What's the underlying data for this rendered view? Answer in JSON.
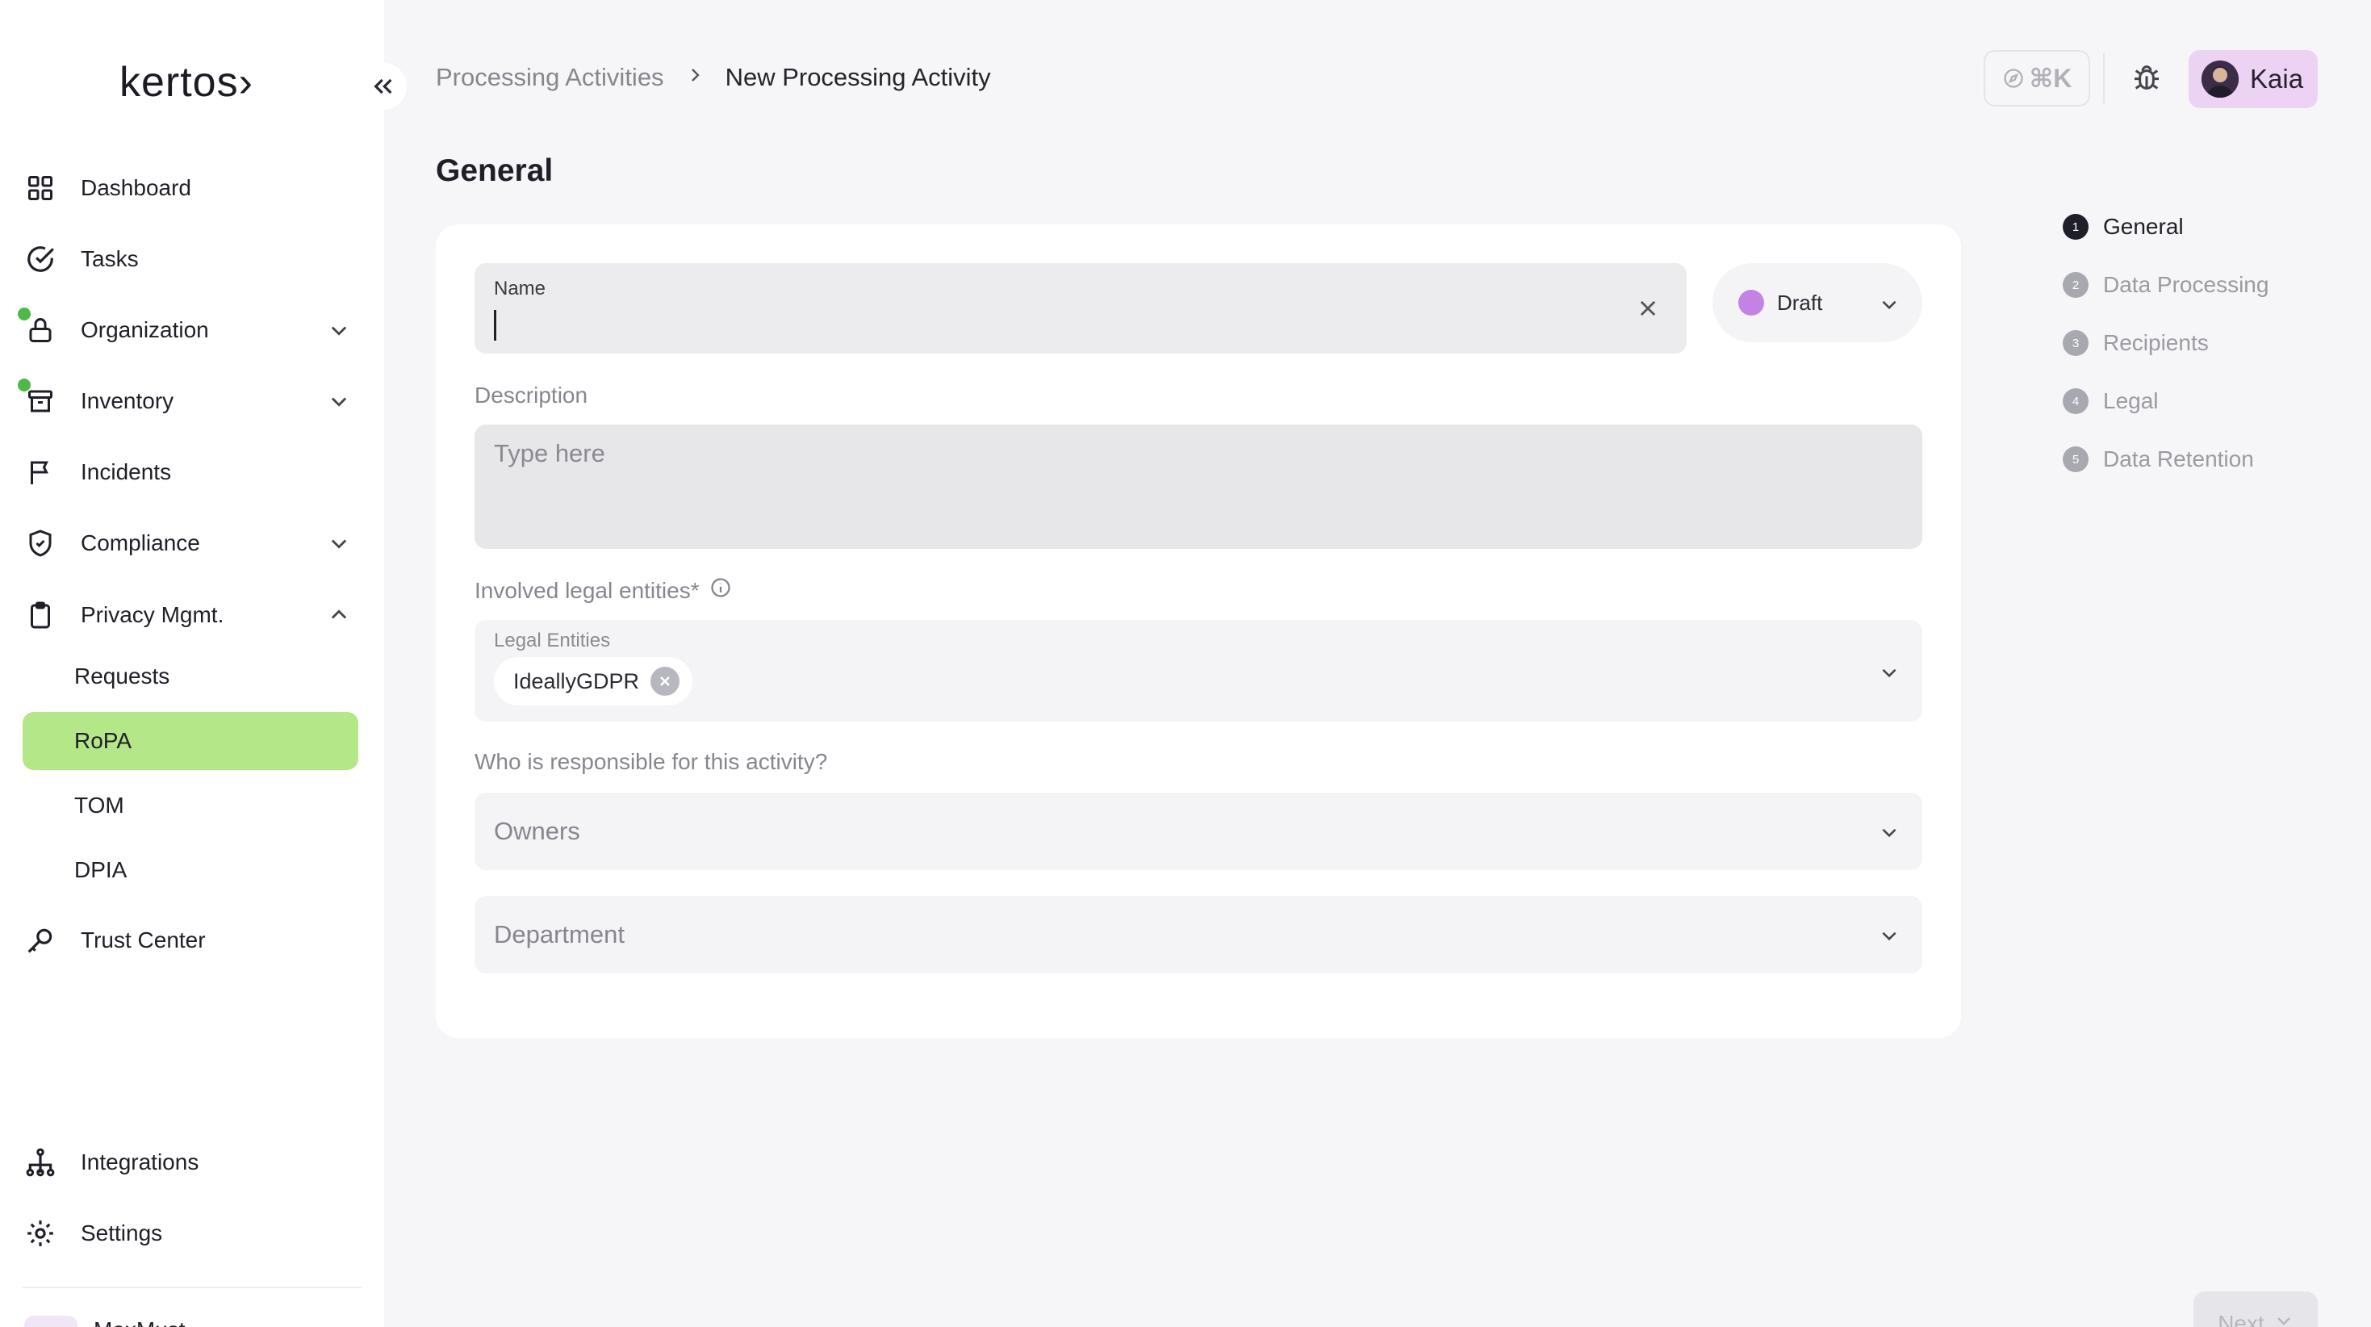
{
  "app": {
    "logo": "kertos›"
  },
  "sidebar": {
    "items": [
      {
        "label": "Dashboard"
      },
      {
        "label": "Tasks"
      },
      {
        "label": "Organization"
      },
      {
        "label": "Inventory"
      },
      {
        "label": "Incidents"
      },
      {
        "label": "Compliance"
      },
      {
        "label": "Privacy Mgmt."
      },
      {
        "label": "Trust Center"
      },
      {
        "label": "Integrations"
      },
      {
        "label": "Settings"
      }
    ],
    "sub_items": [
      {
        "label": "Requests"
      },
      {
        "label": "RoPA"
      },
      {
        "label": "TOM"
      },
      {
        "label": "DPIA"
      }
    ],
    "bottom_text": "MaxMust"
  },
  "header": {
    "breadcrumb": [
      "Processing Activities",
      "New Processing Activity"
    ],
    "shortcut": "⌘K",
    "user": {
      "name": "Kaia"
    }
  },
  "page": {
    "section_title": "General"
  },
  "form": {
    "name": {
      "label": "Name",
      "value": ""
    },
    "status": {
      "value": "Draft",
      "color": "#c383e4"
    },
    "description": {
      "label": "Description",
      "placeholder": "Type here"
    },
    "entities": {
      "question": "Involved legal entities*",
      "label": "Legal Entities",
      "chips": [
        "IdeallyGDPR"
      ]
    },
    "responsible": {
      "question": "Who is responsible for this activity?"
    },
    "owners": {
      "placeholder": "Owners"
    },
    "department": {
      "placeholder": "Department"
    }
  },
  "stepper": [
    {
      "num": "1",
      "label": "General"
    },
    {
      "num": "2",
      "label": "Data Processing"
    },
    {
      "num": "3",
      "label": "Recipients"
    },
    {
      "num": "4",
      "label": "Legal"
    },
    {
      "num": "5",
      "label": "Data Retention"
    }
  ],
  "footer": {
    "next_label": "Next"
  },
  "colors": {
    "accent_active": "#b3e788",
    "user_chip": "#ecd3f4",
    "status_dot": "#c383e4",
    "notification_dot": "#4fb84a"
  }
}
